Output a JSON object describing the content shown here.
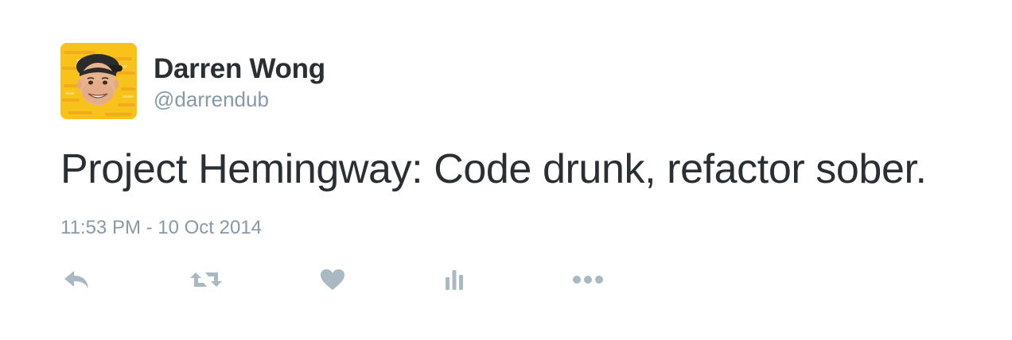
{
  "author": {
    "display_name": "Darren Wong",
    "handle": "@darrendub",
    "avatar_bg": "#f7c21a"
  },
  "tweet": {
    "text": "Project Hemingway: Code drunk, refactor sober.",
    "timestamp": "11:53 PM - 10 Oct 2014"
  },
  "actions": [
    {
      "name": "reply",
      "icon": "reply-icon"
    },
    {
      "name": "retweet",
      "icon": "retweet-icon"
    },
    {
      "name": "like",
      "icon": "heart-icon"
    },
    {
      "name": "analytics",
      "icon": "bar-chart-icon"
    },
    {
      "name": "more",
      "icon": "more-dots-icon"
    }
  ],
  "colors": {
    "text": "#292f33",
    "secondary": "#8899a6",
    "icon": "#aab8c2"
  }
}
